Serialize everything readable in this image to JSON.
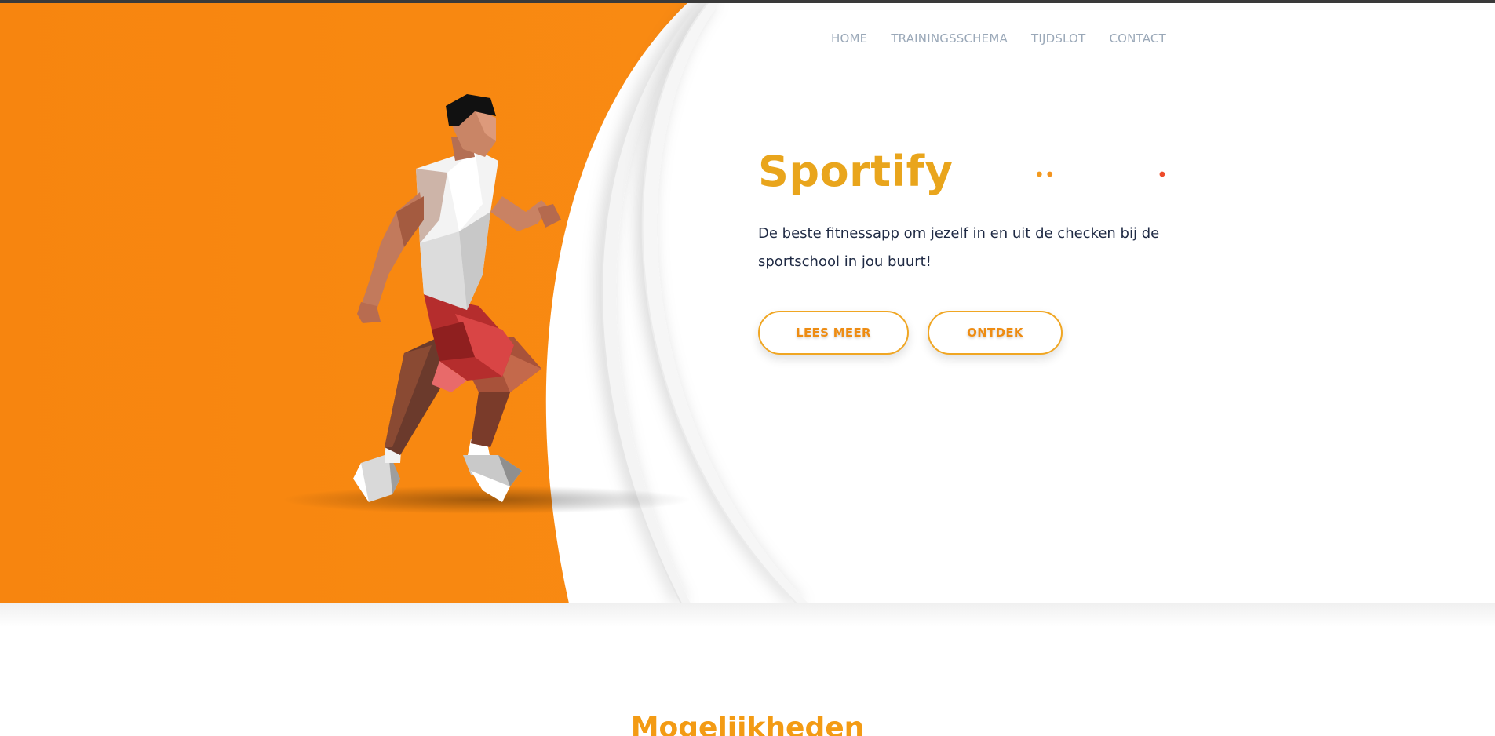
{
  "colors": {
    "accent_orange": "#F7850F",
    "brand_gold": "#E9A51C",
    "button_text": "#EE8C12",
    "nav_text": "#9AA8B8",
    "body_text": "#1F2A44",
    "deco_red": "#EE4B2B"
  },
  "nav": {
    "items": [
      {
        "label": "HOME"
      },
      {
        "label": "TRAININGSSCHEMA"
      },
      {
        "label": "TIJDSLOT"
      },
      {
        "label": "CONTACT"
      }
    ]
  },
  "hero": {
    "title": "Sportify",
    "tagline": "De beste fitnessapp om jezelf in en uit de checken bij de sportschool in jou buurt!",
    "buttons": {
      "lees_meer": "LEES MEER",
      "ontdek": "ONTDEK"
    },
    "image": "running-man-lowpoly-illustration"
  },
  "section": {
    "heading": "Mogelijkheden"
  }
}
